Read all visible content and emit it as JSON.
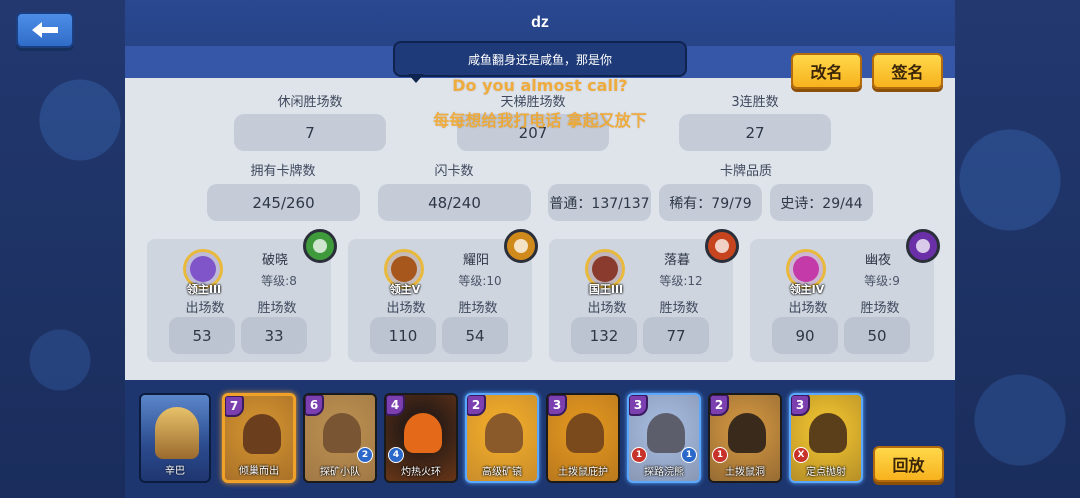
{
  "player_name": "dz",
  "bubble_text": "咸鱼翻身还是咸鱼，那是你",
  "overlay_lines": [
    "Do you almost call?",
    "每每想给我打电话 拿起又放下"
  ],
  "buttons": {
    "rename": "改名",
    "sign": "签名",
    "back_game": "回放"
  },
  "stats_row1": [
    {
      "label": "休闲胜场数",
      "value": "7"
    },
    {
      "label": "天梯胜场数",
      "value": "207"
    },
    {
      "label": "3连胜数",
      "value": "27"
    }
  ],
  "stats_row2": {
    "owned": {
      "label": "拥有卡牌数",
      "value": "245/260"
    },
    "flash": {
      "label": "闪卡数",
      "value": "48/240"
    },
    "quality": {
      "label": "卡牌品质",
      "items": [
        "普通：137/137",
        "稀有：79/79",
        "史诗：29/44"
      ]
    }
  },
  "heroes": [
    {
      "name": "破晓",
      "rank": "领主III",
      "level": "等级:8",
      "appear_label": "出场数",
      "win_label": "胜场数",
      "appear": "53",
      "wins": "33",
      "badge_color": "#3e9a3a",
      "avatar_color": "#7f55c9"
    },
    {
      "name": "耀阳",
      "rank": "领主V",
      "level": "等级:10",
      "appear_label": "出场数",
      "win_label": "胜场数",
      "appear": "110",
      "wins": "54",
      "badge_color": "#d08a1c",
      "avatar_color": "#a7561c"
    },
    {
      "name": "落暮",
      "rank": "国王III",
      "level": "等级:12",
      "appear_label": "出场数",
      "win_label": "胜场数",
      "appear": "132",
      "wins": "77",
      "badge_color": "#c6451f",
      "avatar_color": "#8a3b2e"
    },
    {
      "name": "幽夜",
      "rank": "领主IV",
      "level": "等级:9",
      "appear_label": "出场数",
      "win_label": "胜场数",
      "appear": "90",
      "wins": "50",
      "badge_color": "#6b2fa8",
      "avatar_color": "#c43aa8"
    }
  ],
  "leader": {
    "name": "辛巴"
  },
  "cards": [
    {
      "name": "倾巢而出",
      "cost": "7",
      "bg": "#c98b2e",
      "shape": "#6b3e1e",
      "selected": true
    },
    {
      "name": "探矿小队",
      "cost": "6",
      "bg": "#b58a4e",
      "shape": "#7a5534",
      "tag": "2",
      "tag_color": "blue"
    },
    {
      "name": "灼热火环",
      "cost": "4",
      "bg": "#2b1c16",
      "shape": "#e46a1a",
      "tag": "4",
      "tag_color": "blue",
      "tag_left": true
    },
    {
      "name": "高级矿镐",
      "cost": "2",
      "bg": "#e9a62b",
      "shape": "#8a5a2a",
      "blueglow": true
    },
    {
      "name": "土拨鼠庇护",
      "cost": "3",
      "bg": "#d9901f",
      "shape": "#7a4a1c"
    },
    {
      "name": "探路浣熊",
      "cost": "3",
      "bg": "#9fb3d6",
      "shape": "#5c5f6b",
      "blueglow": true,
      "tag": "1",
      "tag_color": "blue",
      "tag2": "1",
      "tag2_color": "red"
    },
    {
      "name": "土拨鼠洞",
      "cost": "2",
      "bg": "#c48c3e",
      "shape": "#3a2a1c",
      "tag2": "1",
      "tag2_color": "red"
    },
    {
      "name": "定点抛射",
      "cost": "3",
      "bg": "#e3b72e",
      "shape": "#5a3f1a",
      "blueglow": true,
      "tag2": "X",
      "tag2_color": "red"
    }
  ]
}
